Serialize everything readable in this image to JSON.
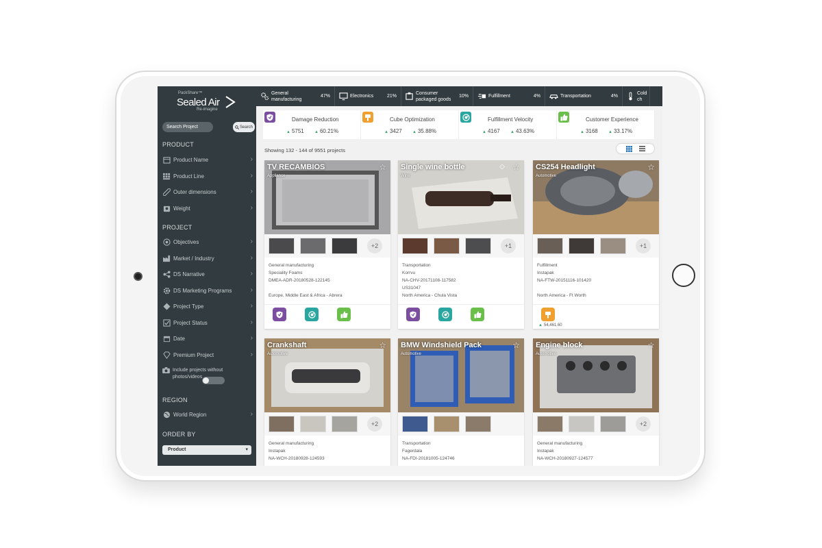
{
  "sidebar": {
    "logo": {
      "sup": "PackShare™",
      "brand": "Sealed Air",
      "tag": "Re-imagine"
    },
    "search": {
      "placeholder": "Search Project",
      "button": "Search"
    },
    "sections": {
      "product": "PRODUCT",
      "project": "PROJECT",
      "region": "REGION",
      "order_by": "ORDER BY"
    },
    "product_items": [
      {
        "label": "Product Name",
        "icon": "box-icon"
      },
      {
        "label": "Product Line",
        "icon": "grid-icon"
      },
      {
        "label": "Outer dimensions",
        "icon": "ruler-icon"
      },
      {
        "label": "Weight",
        "icon": "scale-icon"
      }
    ],
    "project_items": [
      {
        "label": "Objectives",
        "icon": "target-icon"
      },
      {
        "label": "Market / Industry",
        "icon": "factory-icon"
      },
      {
        "label": "DS Narrative",
        "icon": "share-icon"
      },
      {
        "label": "DS Marketing Programs",
        "icon": "gear-icon"
      },
      {
        "label": "Project Type",
        "icon": "diamond-icon"
      },
      {
        "label": "Project Status",
        "icon": "checkbox-icon"
      },
      {
        "label": "Date",
        "icon": "calendar-icon"
      },
      {
        "label": "Premium Project",
        "icon": "gem-icon"
      }
    ],
    "toggle_label": "Include projects without photos/videos",
    "region_items": [
      {
        "label": "World Region",
        "icon": "globe-icon"
      }
    ],
    "order_value": "Product"
  },
  "industries": [
    {
      "name": "General manufacturing",
      "pct": "47%",
      "icon": "gears-icon"
    },
    {
      "name": "Electronics",
      "pct": "21%",
      "icon": "monitor-icon"
    },
    {
      "name": "Consumer packaged goods",
      "pct": "10%",
      "icon": "package-icon"
    },
    {
      "name": "Fulfillment",
      "pct": "4%",
      "icon": "fulfillment-icon"
    },
    {
      "name": "Transportation",
      "pct": "4%",
      "icon": "car-icon"
    },
    {
      "name": "Cold ch",
      "pct": "",
      "icon": "thermometer-icon"
    }
  ],
  "objectives": [
    {
      "title": "Damage Reduction",
      "count": "5751",
      "pct": "60.21%",
      "color": "#7b4ea0",
      "icon": "shield-icon"
    },
    {
      "title": "Cube Optimization",
      "count": "3427",
      "pct": "35.88%",
      "color": "#f0a030",
      "icon": "cube-icon"
    },
    {
      "title": "Fulfillment Velocity",
      "count": "4167",
      "pct": "43.63%",
      "color": "#2aa6a0",
      "icon": "speed-icon"
    },
    {
      "title": "Customer Experience",
      "count": "3168",
      "pct": "33.17%",
      "color": "#6abf4b",
      "icon": "thumbs-up-icon"
    }
  ],
  "showing": "Showing 132 - 144 of 9551 projects",
  "cards": [
    {
      "title": "TV RECAMBIOS",
      "sub": "Appliance",
      "more": "+2",
      "meta": [
        "General manufacturing",
        "Speciality Foams",
        "DMEA-ADR-20180528-122145",
        "",
        "Europe, Middle East & Africa - Abrera"
      ],
      "price": ""
    },
    {
      "title": "Single wine bottle",
      "sub": "Wine",
      "more": "+1",
      "meta": [
        "Transportation",
        "Korrvu",
        "NA-CHV-20171108-117582",
        "US31047",
        "North America - Chula Vista"
      ],
      "price": ""
    },
    {
      "title": "CS254 Headlight",
      "sub": "Automotive",
      "more": "+1",
      "meta": [
        "Fulfillment",
        "Instapak",
        "NA-FTW-20151116-101420",
        "",
        "North America - Ft Worth"
      ],
      "price": "54,461.60"
    },
    {
      "title": "Crankshaft",
      "sub": "Automotive",
      "more": "+2",
      "meta": [
        "General manufacturing",
        "Instapak",
        "NA-WCH-20180928-124593"
      ],
      "price": ""
    },
    {
      "title": "BMW Windshield Pack",
      "sub": "Automotive",
      "more": "",
      "meta": [
        "Transportation",
        "Fagerdala",
        "NA-FDI-20181005-124746"
      ],
      "price": ""
    },
    {
      "title": "Engine block",
      "sub": "Automotive",
      "more": "+2",
      "meta": [
        "General manufacturing",
        "Instapak",
        "NA-WCH-20180927-124577"
      ],
      "price": ""
    }
  ]
}
